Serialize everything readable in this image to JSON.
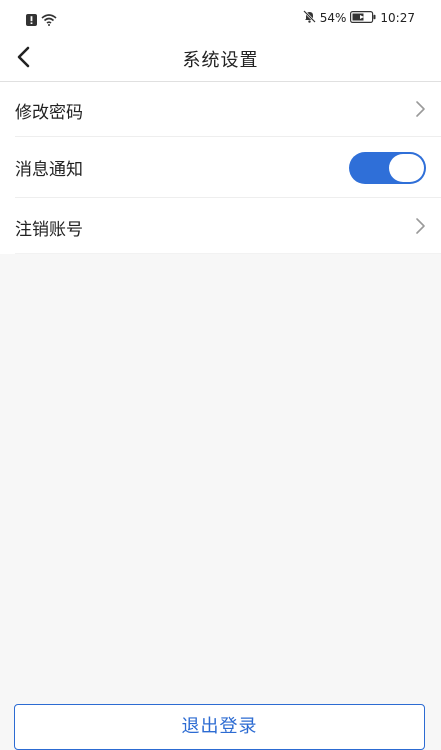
{
  "status_bar": {
    "battery": "54%",
    "time": "10:27",
    "icons": [
      "alert-icon",
      "wifi-icon",
      "mute-bell-icon",
      "battery-icon"
    ]
  },
  "header": {
    "title": "系统设置",
    "back_icon": "back-chevron-icon"
  },
  "settings": {
    "items": [
      {
        "label": "修改密码",
        "control": "chevron"
      },
      {
        "label": "消息通知",
        "control": "toggle",
        "toggle_on": true
      },
      {
        "label": "注销账号",
        "control": "chevron"
      }
    ]
  },
  "footer": {
    "logout_label": "退出登录"
  },
  "colors": {
    "accent": "#2c6bd2",
    "toggle_on": "#2f6fd8",
    "background": "#f7f7f7"
  }
}
